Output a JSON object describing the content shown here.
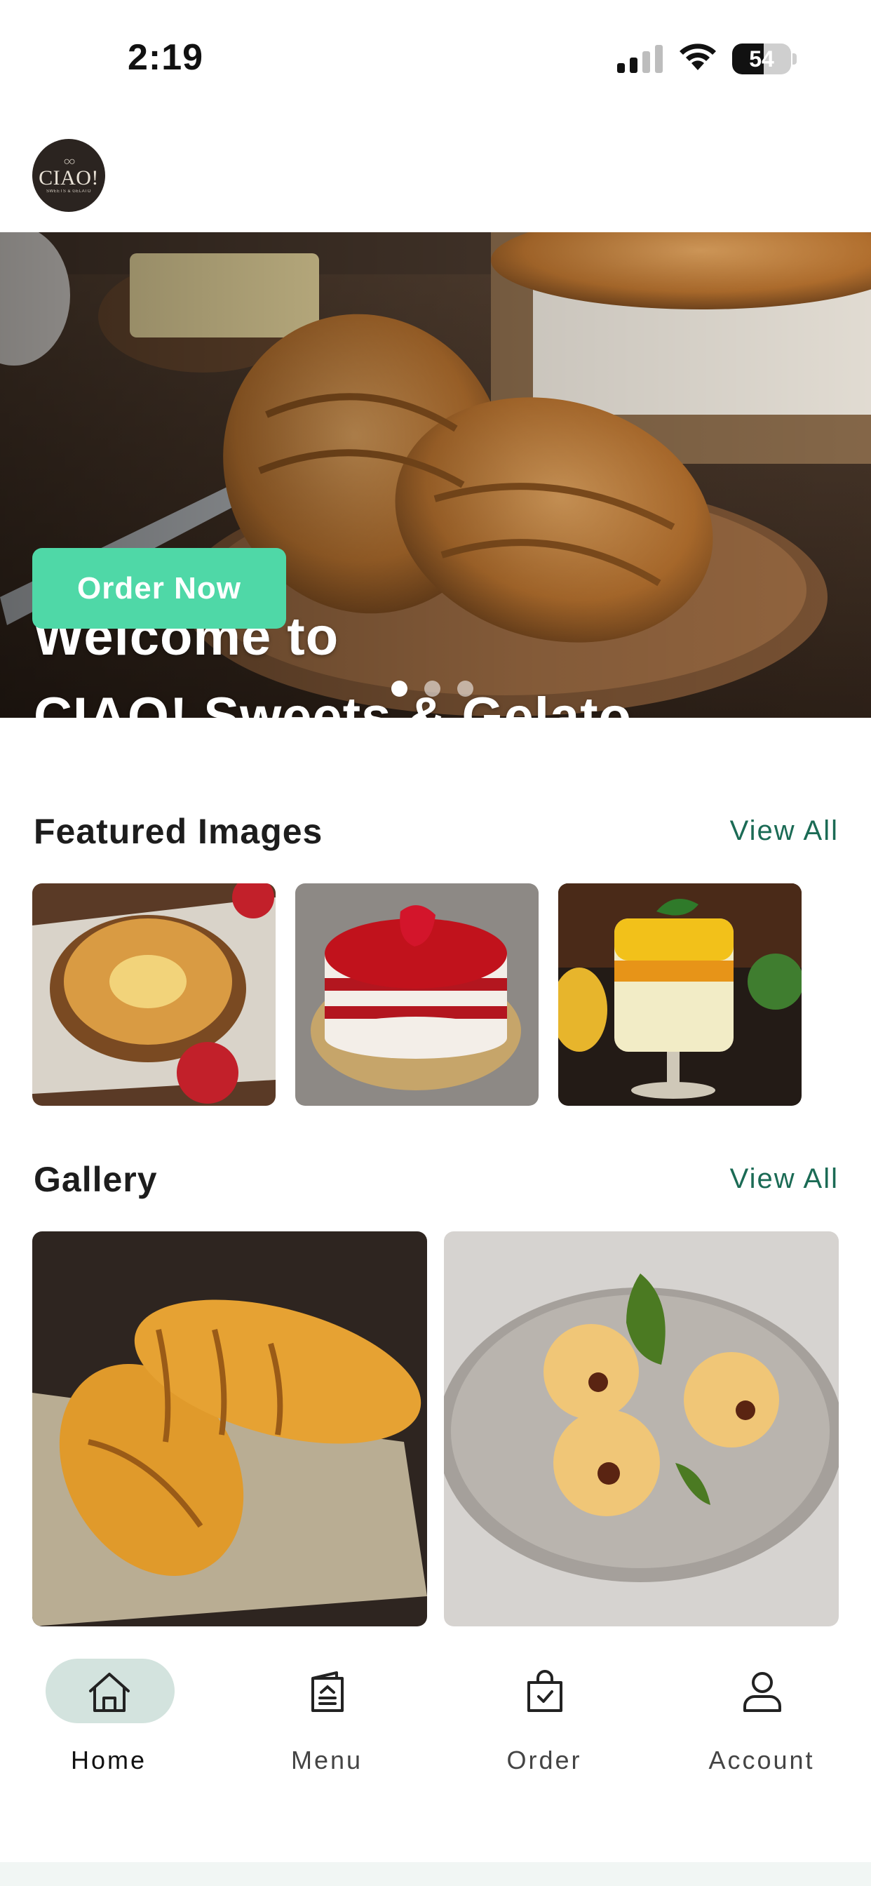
{
  "status_bar": {
    "time": "2:19",
    "battery_level": "54",
    "battery_fraction": 0.54,
    "signal_icon": "cellular-signal-icon",
    "wifi_icon": "wifi-icon"
  },
  "header": {
    "logo_text": "CIAO!",
    "logo_sub": "SWEETS & GELATO"
  },
  "hero": {
    "title_line1": "Welcome to",
    "title_line2": "CIAO! Sweets & Gelato",
    "cta_label": "Order Now",
    "slides_total": 3,
    "active_slide": 1,
    "accent_color": "#4fd8a7"
  },
  "featured": {
    "title": "Featured Images",
    "view_all": "View All",
    "items": [
      "almond-custard-pastry",
      "red-velvet-cake",
      "mango-mousse-glass"
    ]
  },
  "gallery": {
    "title": "Gallery",
    "view_all": "View All",
    "items": [
      "croissants-on-burlap",
      "cream-buns-on-plate"
    ]
  },
  "bottom_nav": {
    "items": [
      {
        "label": "Home",
        "icon": "home-icon",
        "active": true
      },
      {
        "label": "Menu",
        "icon": "menu-book-icon",
        "active": false
      },
      {
        "label": "Order",
        "icon": "shopping-bag-icon",
        "active": false
      },
      {
        "label": "Account",
        "icon": "user-icon",
        "active": false
      }
    ],
    "active_color": "#d3e3de"
  },
  "colors": {
    "link": "#1b6b55",
    "cta": "#4fd8a7"
  }
}
